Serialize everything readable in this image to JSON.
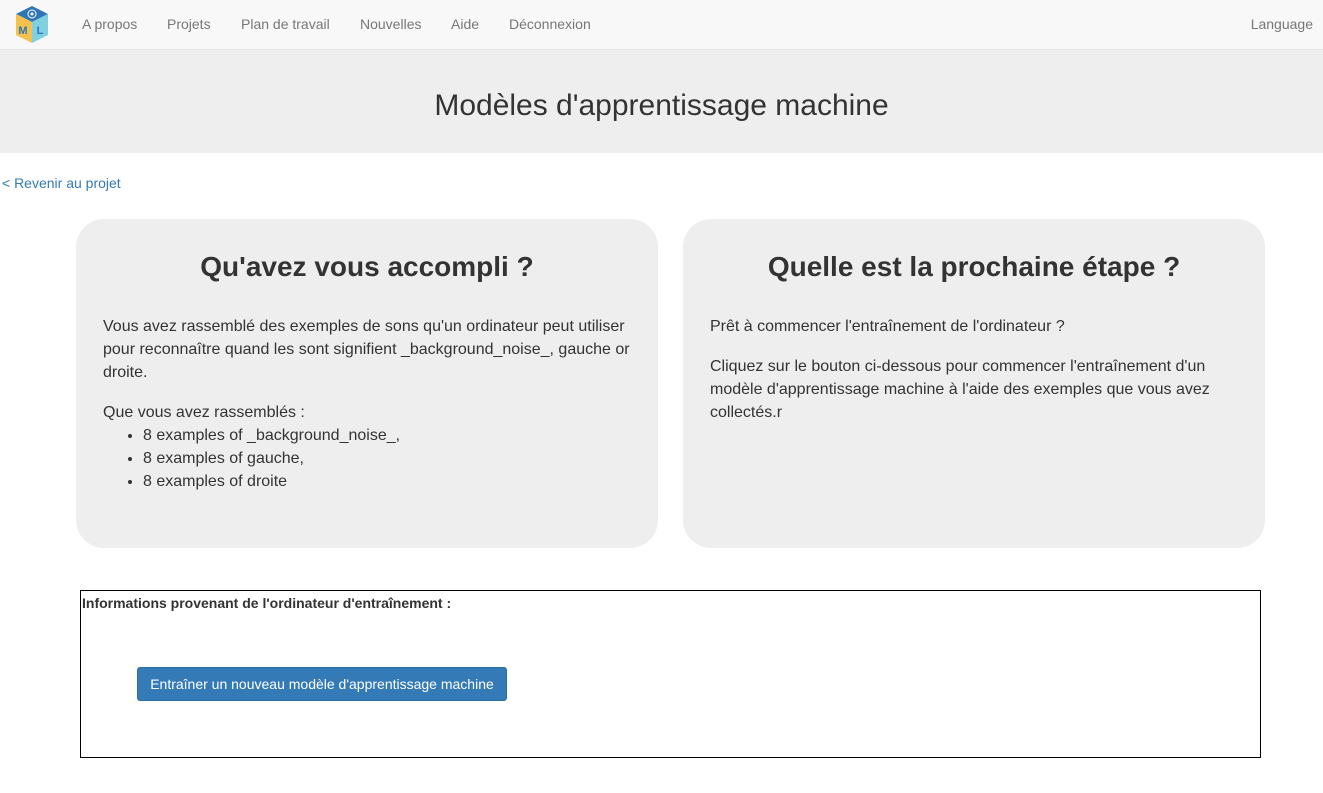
{
  "nav": {
    "logo_letters": [
      "M",
      "L"
    ],
    "items": [
      {
        "label": "A propos"
      },
      {
        "label": "Projets"
      },
      {
        "label": "Plan de travail"
      },
      {
        "label": "Nouvelles"
      },
      {
        "label": "Aide"
      },
      {
        "label": "Déconnexion"
      }
    ],
    "language": "Language"
  },
  "banner": {
    "title": "Modèles d'apprentissage machine"
  },
  "back_link": "< Revenir au projet",
  "left_panel": {
    "title": "Qu'avez vous accompli ?",
    "paragraph": "Vous avez rassemblé des exemples de sons qu'un ordinateur peut utiliser pour reconnaître quand les sont signifient _background_noise_, gauche or droite.",
    "list_intro": "Que vous avez rassemblés :",
    "items": [
      "8 examples of _background_noise_,",
      "8 examples of gauche,",
      "8 examples of droite"
    ]
  },
  "right_panel": {
    "title": "Quelle est la prochaine étape ?",
    "paragraph1": "Prêt à commencer l'entraînement de l'ordinateur ?",
    "paragraph2": "Cliquez sur le bouton ci-dessous pour commencer l'entraînement d'un modèle d'apprentissage machine à l'aide des exemples que vous avez collectés.r"
  },
  "info": {
    "title": "Informations provenant de l'ordinateur d'entraînement :",
    "button_label": "Entraîner un nouveau modèle d'apprentissage machine"
  },
  "colors": {
    "accent": "#337ab7",
    "panel_bg": "#eeeeee",
    "navbar_bg": "#f8f8f8"
  }
}
